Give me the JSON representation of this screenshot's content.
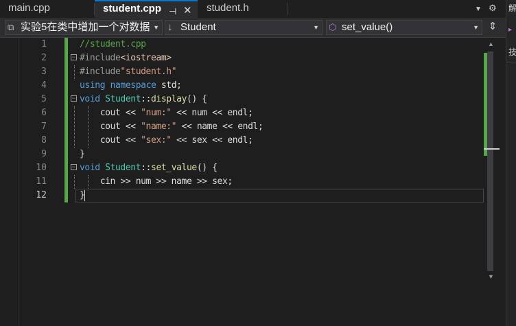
{
  "tabs": [
    {
      "label": "main.cpp",
      "active": false
    },
    {
      "label": "student.cpp",
      "active": true,
      "pin_icon": "pin-icon",
      "close_icon": "close-icon"
    },
    {
      "label": "student.h",
      "active": false
    }
  ],
  "tabbar_actions": {
    "overflow_icon": "chevron-down-icon",
    "settings_icon": "gear-icon"
  },
  "side_panel": {
    "chars": [
      "解",
      "▸",
      "技"
    ]
  },
  "nav": {
    "project": "实验5在类中增加一个对数据",
    "scope": "Student",
    "member": "set_value()"
  },
  "editor": {
    "current_line": 12,
    "lines": [
      {
        "n": "1",
        "code": "//student.cpp"
      },
      {
        "n": "2",
        "code": "#include<iostream>"
      },
      {
        "n": "3",
        "code": "#include\"student.h\""
      },
      {
        "n": "4",
        "code": "using namespace std;"
      },
      {
        "n": "5",
        "code": "void Student::display() {"
      },
      {
        "n": "6",
        "code": "    cout << \"num:\" << num << endl;"
      },
      {
        "n": "7",
        "code": "    cout << \"name:\" << name << endl;"
      },
      {
        "n": "8",
        "code": "    cout << \"sex:\" << sex << endl;"
      },
      {
        "n": "9",
        "code": "}"
      },
      {
        "n": "10",
        "code": "void Student::set_value() {"
      },
      {
        "n": "11",
        "code": "    cin >> num >> name >> sex;"
      },
      {
        "n": "12",
        "code": "}"
      }
    ]
  },
  "colors": {
    "accent": "#0078d4",
    "change_bar": "#57a64a",
    "keyword": "#569cd6",
    "type": "#4ec9b0",
    "string": "#d69d85"
  }
}
